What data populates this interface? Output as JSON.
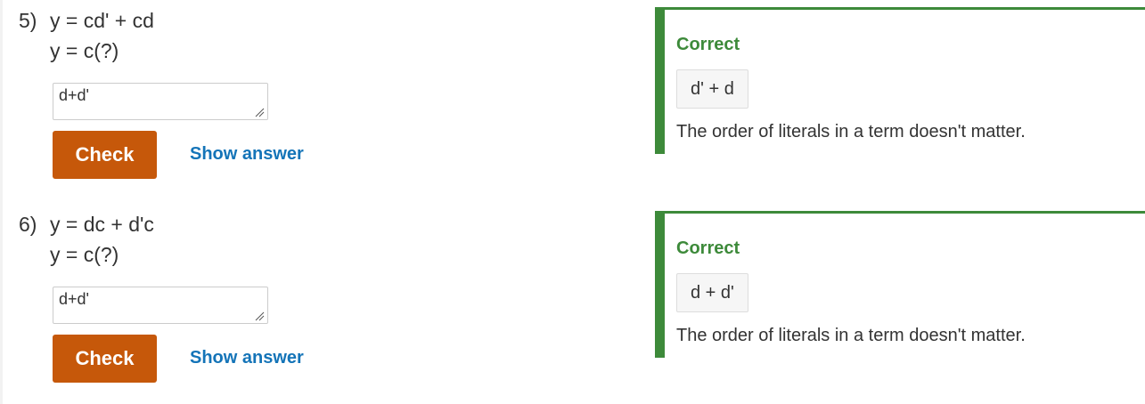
{
  "questions": [
    {
      "number": "5)",
      "expression": "y = cd' + cd",
      "target": "y = c(?)",
      "input_value": "d+d'",
      "check_label": "Check",
      "show_answer_label": "Show answer",
      "feedback": {
        "status": "Correct",
        "answer": "d' + d",
        "explanation": "The order of literals in a term doesn't matter."
      }
    },
    {
      "number": "6)",
      "expression": "y = dc + d'c",
      "target": "y = c(?)",
      "input_value": "d+d'",
      "check_label": "Check",
      "show_answer_label": "Show answer",
      "feedback": {
        "status": "Correct",
        "answer": "d + d'",
        "explanation": "The order of literals in a term doesn't matter."
      }
    }
  ],
  "colors": {
    "check_button": "#c6580a",
    "correct_green": "#3d8a3a",
    "link_blue": "#1474b8"
  }
}
